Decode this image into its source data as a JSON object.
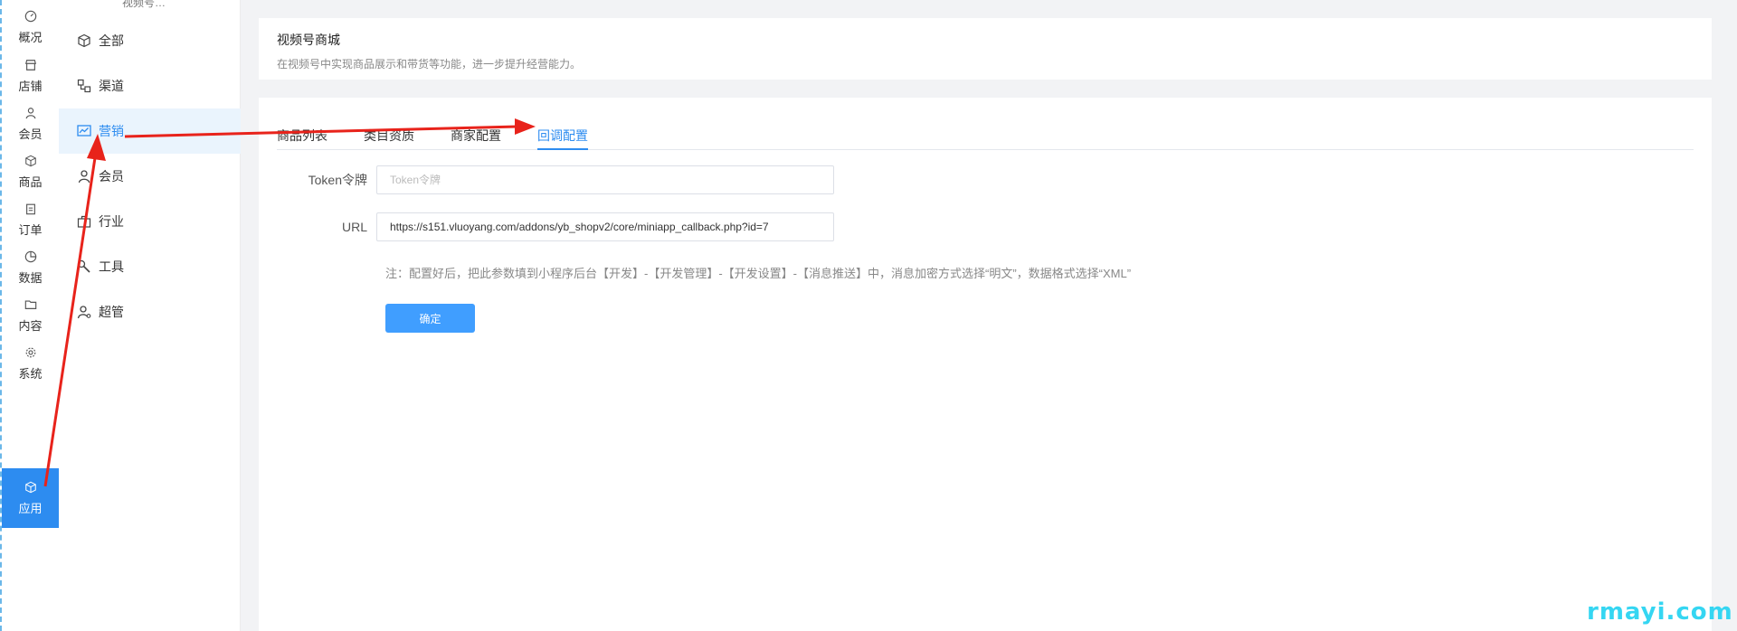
{
  "rail": {
    "items": [
      {
        "label": "概况",
        "icon": "dashboard-icon"
      },
      {
        "label": "店铺",
        "icon": "store-icon"
      },
      {
        "label": "会员",
        "icon": "user-icon"
      },
      {
        "label": "商品",
        "icon": "box-icon"
      },
      {
        "label": "订单",
        "icon": "clipboard-icon"
      },
      {
        "label": "数据",
        "icon": "pie-chart-icon"
      },
      {
        "label": "内容",
        "icon": "folder-icon"
      },
      {
        "label": "系统",
        "icon": "gear-icon"
      },
      {
        "label": "应用",
        "icon": "cube-icon"
      }
    ]
  },
  "sub": {
    "title": "视频号…",
    "items": [
      {
        "label": "全部",
        "icon": "cube-icon"
      },
      {
        "label": "渠道",
        "icon": "channel-icon"
      },
      {
        "label": "营销",
        "icon": "trend-chart-icon"
      },
      {
        "label": "会员",
        "icon": "user-icon"
      },
      {
        "label": "行业",
        "icon": "briefcase-icon"
      },
      {
        "label": "工具",
        "icon": "wrench-icon"
      },
      {
        "label": "超管",
        "icon": "admin-icon"
      }
    ]
  },
  "header": {
    "title": "视频号商城",
    "desc": "在视频号中实现商品展示和带货等功能，进一步提升经营能力。"
  },
  "tabs": [
    "商品列表",
    "类目资质",
    "商家配置",
    "回调配置"
  ],
  "form": {
    "token_label": "Token令牌",
    "token_placeholder": "Token令牌",
    "url_label": "URL",
    "url_value": "https://s151.vluoyang.com/addons/yb_shopv2/core/miniapp_callback.php?id=7",
    "note": "注：配置好后，把此参数填到小程序后台【开发】-【开发管理】-【开发设置】-【消息推送】中，消息加密方式选择“明文”，数据格式选择“XML”",
    "submit": "确定"
  },
  "watermark": "rmayi.com",
  "colors": {
    "accent": "#2d8cf0",
    "button": "#409eff",
    "arrow": "#e8231b",
    "watermark": "#35d6f2"
  }
}
